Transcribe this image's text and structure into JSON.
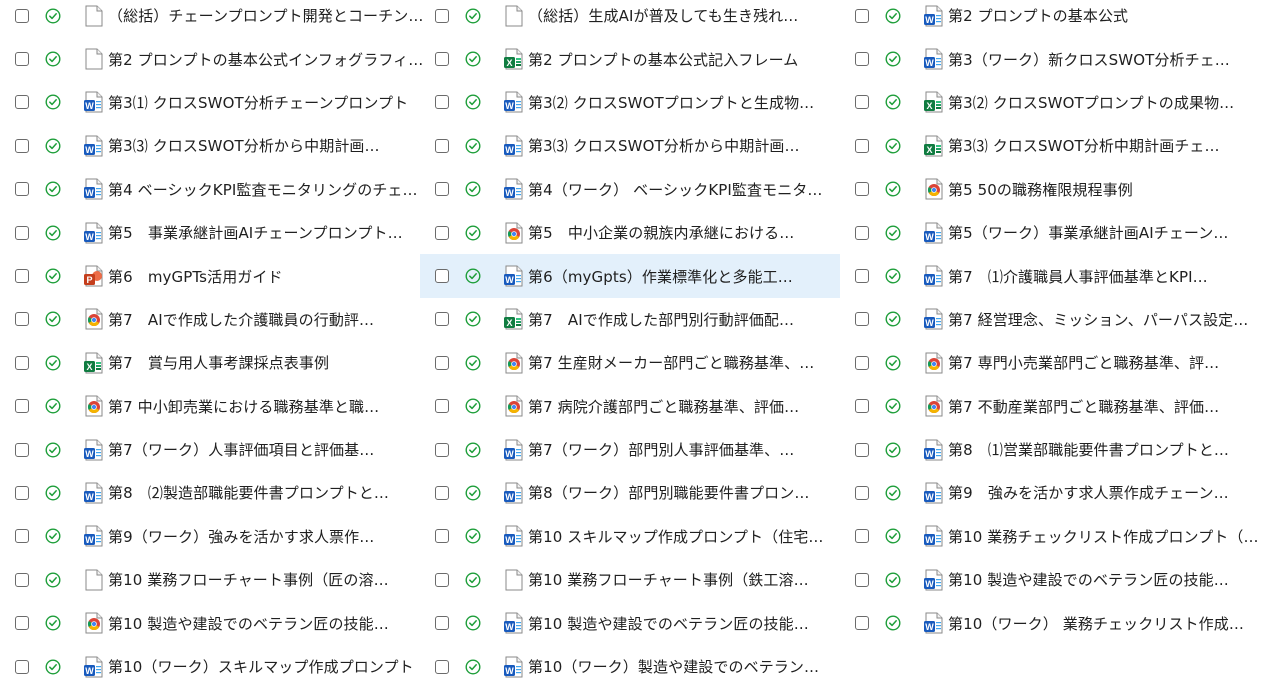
{
  "files": [
    {
      "name": "（総括）チェーンプロンプト開発とコーチン…",
      "type": "blank"
    },
    {
      "name": "（総括）生成AIが普及しても生き残れ…",
      "type": "blank"
    },
    {
      "name": "第2 プロンプトの基本公式",
      "type": "word"
    },
    {
      "name": "第2 プロンプトの基本公式インフォグラフィ…",
      "type": "blank"
    },
    {
      "name": "第2 プロンプトの基本公式記入フレーム",
      "type": "excel"
    },
    {
      "name": "第3（ワーク）新クロスSWOT分析チェ…",
      "type": "word"
    },
    {
      "name": "第3⑴ クロスSWOT分析チェーンプロンプト",
      "type": "word"
    },
    {
      "name": "第3⑵ クロスSWOTプロンプトと生成物…",
      "type": "word"
    },
    {
      "name": "第3⑵ クロスSWOTプロンプトの成果物…",
      "type": "excel"
    },
    {
      "name": "第3⑶ クロスSWOT分析から中期計画…",
      "type": "word"
    },
    {
      "name": "第3⑶ クロスSWOT分析から中期計画…",
      "type": "word"
    },
    {
      "name": "第3⑶ クロスSWOT分析中期計画チェ…",
      "type": "excel"
    },
    {
      "name": "第4 ベーシックKPI監査モニタリングのチェ…",
      "type": "word"
    },
    {
      "name": "第4（ワーク） ベーシックKPI監査モニタ…",
      "type": "word"
    },
    {
      "name": "第5 50の職務権限規程事例",
      "type": "chrome"
    },
    {
      "name": "第5　事業承継計画AIチェーンプロンプト…",
      "type": "word"
    },
    {
      "name": "第5　中小企業の親族内承継における…",
      "type": "chrome"
    },
    {
      "name": "第5（ワーク）事業承継計画AIチェーン…",
      "type": "word"
    },
    {
      "name": "第6　myGPTs活用ガイド",
      "type": "ppt"
    },
    {
      "name": "第6（myGpts）作業標準化と多能工…",
      "type": "word"
    },
    {
      "name": "第7　⑴介護職員人事評価基準とKPI…",
      "type": "word"
    },
    {
      "name": "第7　AIで作成した介護職員の行動評…",
      "type": "chrome"
    },
    {
      "name": "第7　AIで作成した部門別行動評価配…",
      "type": "excel"
    },
    {
      "name": "第7 経営理念、ミッション、パーパス設定…",
      "type": "word"
    },
    {
      "name": "第7　賞与用人事考課採点表事例",
      "type": "excel"
    },
    {
      "name": "第7 生産財メーカー部門ごと職務基準、…",
      "type": "chrome"
    },
    {
      "name": "第7 専門小売業部門ごと職務基準、評…",
      "type": "chrome"
    },
    {
      "name": "第7 中小卸売業における職務基準と職…",
      "type": "chrome"
    },
    {
      "name": "第7 病院介護部門ごと職務基準、評価…",
      "type": "chrome"
    },
    {
      "name": "第7 不動産業部門ごと職務基準、評価…",
      "type": "chrome"
    },
    {
      "name": "第7（ワーク）人事評価項目と評価基…",
      "type": "word"
    },
    {
      "name": "第7（ワーク）部門別人事評価基準、…",
      "type": "word"
    },
    {
      "name": "第8　⑴営業部職能要件書プロンプトと…",
      "type": "word"
    },
    {
      "name": "第8　⑵製造部職能要件書プロンプトと…",
      "type": "word"
    },
    {
      "name": "第8（ワーク）部門別職能要件書プロン…",
      "type": "word"
    },
    {
      "name": "第9　強みを活かす求人票作成チェーン…",
      "type": "word"
    },
    {
      "name": "第9（ワーク）強みを活かす求人票作…",
      "type": "word"
    },
    {
      "name": "第10 スキルマップ作成プロンプト（住宅…",
      "type": "word"
    },
    {
      "name": "第10 業務チェックリスト作成プロンプト（…",
      "type": "word"
    },
    {
      "name": "第10 業務フローチャート事例（匠の溶…",
      "type": "blank"
    },
    {
      "name": "第10 業務フローチャート事例（鉄工溶…",
      "type": "blank"
    },
    {
      "name": "第10 製造や建設でのベテラン匠の技能…",
      "type": "word"
    },
    {
      "name": "第10 製造や建設でのベテラン匠の技能…",
      "type": "chrome"
    },
    {
      "name": "第10 製造や建設でのベテラン匠の技能…",
      "type": "word"
    },
    {
      "name": "第10（ワーク） 業務チェックリスト作成…",
      "type": "word"
    },
    {
      "name": "第10（ワーク）スキルマップ作成プロンプト",
      "type": "word"
    },
    {
      "name": "第10（ワーク）製造や建設でのベテラン…",
      "type": "word"
    }
  ],
  "selected_index": 19,
  "colors": {
    "selected_bg": "#e3f0fb",
    "sync_green": "#1e9e3a",
    "word_blue": "#185abd",
    "excel_green": "#107c41",
    "ppt_red": "#c43e1c"
  }
}
